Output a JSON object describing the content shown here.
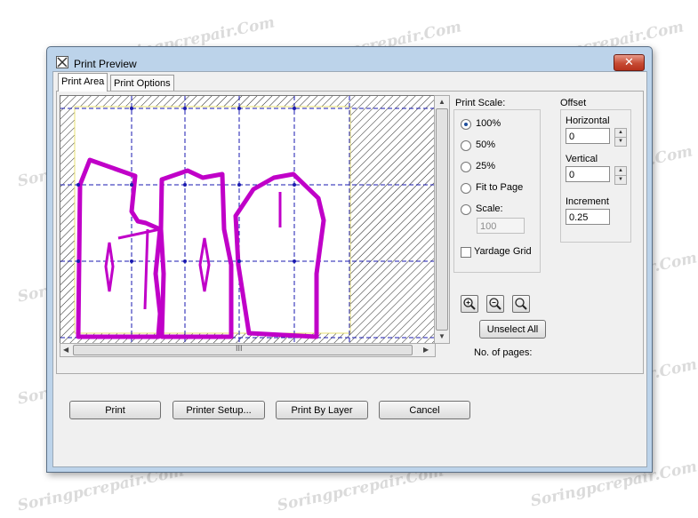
{
  "watermark": "Soringpcrepair.Com",
  "window": {
    "title": "Print Preview",
    "close_label": "✕"
  },
  "tabs": [
    {
      "label": "Print Area"
    },
    {
      "label": "Print Options"
    }
  ],
  "print_scale": {
    "label": "Print Scale:",
    "options": [
      {
        "label": "100%",
        "checked": true
      },
      {
        "label": "50%"
      },
      {
        "label": "25%"
      },
      {
        "label": "Fit to Page"
      },
      {
        "label": "Scale:"
      }
    ],
    "scale_value": "100",
    "yardage_grid_label": "Yardage Grid"
  },
  "offset": {
    "label": "Offset",
    "horizontal_label": "Horizontal",
    "horizontal_value": "0",
    "vertical_label": "Vertical",
    "vertical_value": "0",
    "increment_label": "Increment",
    "increment_value": "0.25"
  },
  "zoom": {
    "icons": [
      "zoom-in-icon",
      "zoom-out-icon",
      "zoom-fit-icon"
    ]
  },
  "unselect_all_label": "Unselect All",
  "pages_label": "No. of pages:",
  "scrollbar_grip": "III",
  "buttons": {
    "print": "Print",
    "printer_setup": "Printer Setup...",
    "print_by_layer": "Print By Layer",
    "cancel": "Cancel"
  },
  "colors": {
    "pattern_piece": "#c000c8",
    "grid_line": "#1a1ab0",
    "print_area_border": "#e8e070",
    "hatch": "#222222"
  }
}
